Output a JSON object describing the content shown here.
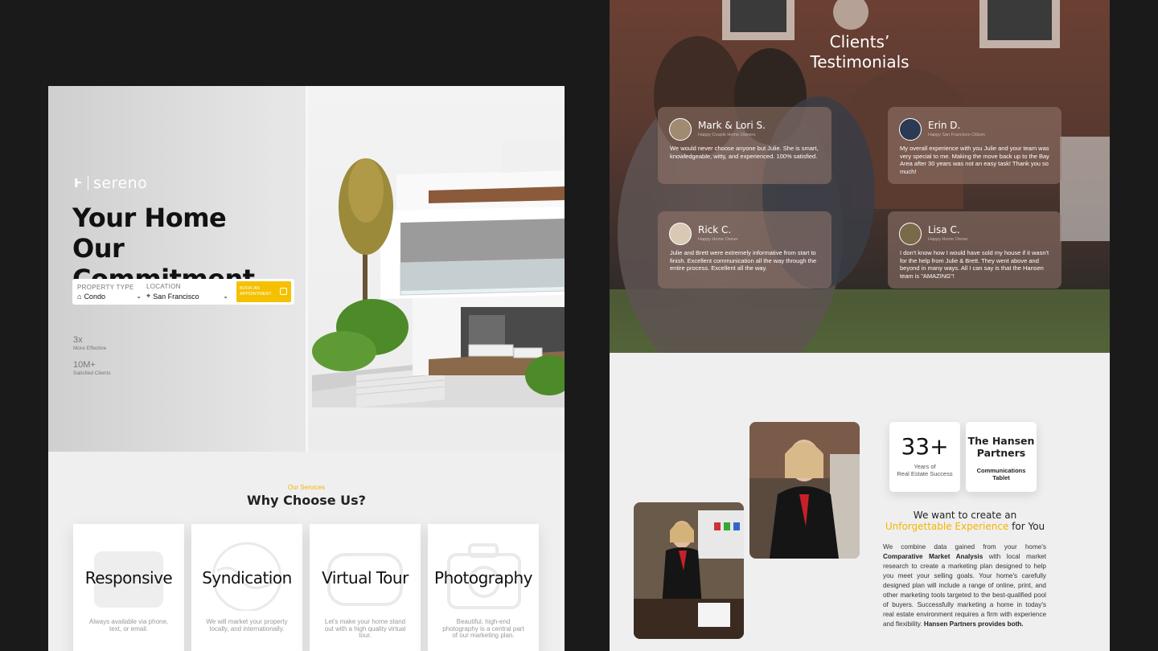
{
  "left": {
    "brand": "sereno",
    "brand_mark": "Ⱶ",
    "hero_title_line1": "Your Home",
    "hero_title_line2": "Our Commitment",
    "search": {
      "property_type_label": "PROPERTY TYPE",
      "property_type_value": "Condo",
      "location_label": "LOCATION",
      "location_value": "San Francisco",
      "book_button_line1": "BOOK AN",
      "book_button_line2": "APPOINTMENT"
    },
    "stats": [
      {
        "value": "3x",
        "label": "More Effective"
      },
      {
        "value": "10M+",
        "label": "Satisfied Clients"
      }
    ],
    "services_eyebrow": "Our Services",
    "services_title": "Why Choose Us?",
    "services": [
      {
        "title": "Responsive",
        "desc": "Always available via phone, text, or email.",
        "icon": "mail-icon",
        "progress": 0.25
      },
      {
        "title": "Syndication",
        "desc": "We will market your property locally, and internationally.",
        "icon": "globe-icon",
        "progress": 0.5
      },
      {
        "title": "Virtual Tour",
        "desc": "Let's make your home stand out with a high quality virtual tour.",
        "icon": "vr-headset-icon",
        "progress": 0.75
      },
      {
        "title": "Photography",
        "desc": "Beautiful, high-end photography is a central part of our marketing plan.",
        "icon": "camera-icon",
        "progress": 1.0
      }
    ]
  },
  "right": {
    "testimonials_title_line1": "Clients’",
    "testimonials_title_line2": "Testimonials",
    "testimonials": [
      {
        "name": "Mark & Lori S.",
        "role": "Happy Couple Home Owners",
        "text": "We would never choose anyone but Julie. She is smart, knowledgeable, witty, and experienced. 100% satisfied."
      },
      {
        "name": "Erin D.",
        "role": "Happy San Francisco Citizen",
        "text": "My overall experience with you Julie and your team was very special to me. Making the move back up to the Bay Area after 30 years was not an easy task! Thank you so much!"
      },
      {
        "name": "Rick C.",
        "role": "Happy Home Owner",
        "text": "Julie and Brett were extremely informative from start to finish. Excellent communication all the way through the entire process. Excellent all the way."
      },
      {
        "name": "Lisa C.",
        "role": "Happy Home Owner",
        "text": "I don't know how I would have sold my house if it wasn't for the help from Julie & Brett. They went above and beyond in many ways. All I can say is that the Hansen team is \"AMAZING\"!"
      }
    ],
    "badge1_value": "33+",
    "badge1_label_line1": "Years of",
    "badge1_label_line2": "Real Estate Success",
    "badge2_title_line1": "The Hansen",
    "badge2_title_line2": "Partners",
    "badge2_label_line1": "Communications",
    "badge2_label_line2": "Tablet",
    "about_head_line1": "We want to create an",
    "about_head_highlight": "Unforgettable Experience",
    "about_head_tail": " for You",
    "about_body_1": "We combine data gained from your home's ",
    "about_body_bold1": "Comparative Market Analysis",
    "about_body_2": " with local market research to create a marketing plan designed to help you meet your selling goals. Your home's carefully designed plan will include a range of online, print, and other marketing tools targeted to the best-qualified pool of buyers. Successfully marketing a home in today's real estate environment requires a firm with experience and flexibility. ",
    "about_body_bold2": "Hansen Partners provides both."
  },
  "colors": {
    "accent": "#f5c000",
    "dark": "#1a1a1a"
  }
}
